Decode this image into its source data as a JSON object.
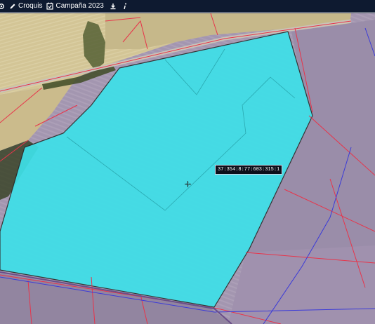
{
  "toolbar": {
    "items": [
      {
        "label": "",
        "icon": "eye-icon"
      },
      {
        "label": "Croquis",
        "icon": "pencil-icon"
      },
      {
        "label": "Campaña 2023",
        "icon": "calendar-check-icon"
      },
      {
        "label": "",
        "icon": "download-icon"
      },
      {
        "label": "",
        "icon": "info-icon"
      }
    ]
  },
  "map": {
    "coordinate_readout": "37:354:8:77:603:315:1",
    "colors": {
      "selected_parcel": "#3ee0e8",
      "parcel_border_red": "#e8344a",
      "parcel_border_blue": "#3b3bd8",
      "farmland_purple": "#9b8eaa",
      "farmland_tan": "#cdbd8f",
      "toolbar_bg": "#0e1a30"
    }
  }
}
